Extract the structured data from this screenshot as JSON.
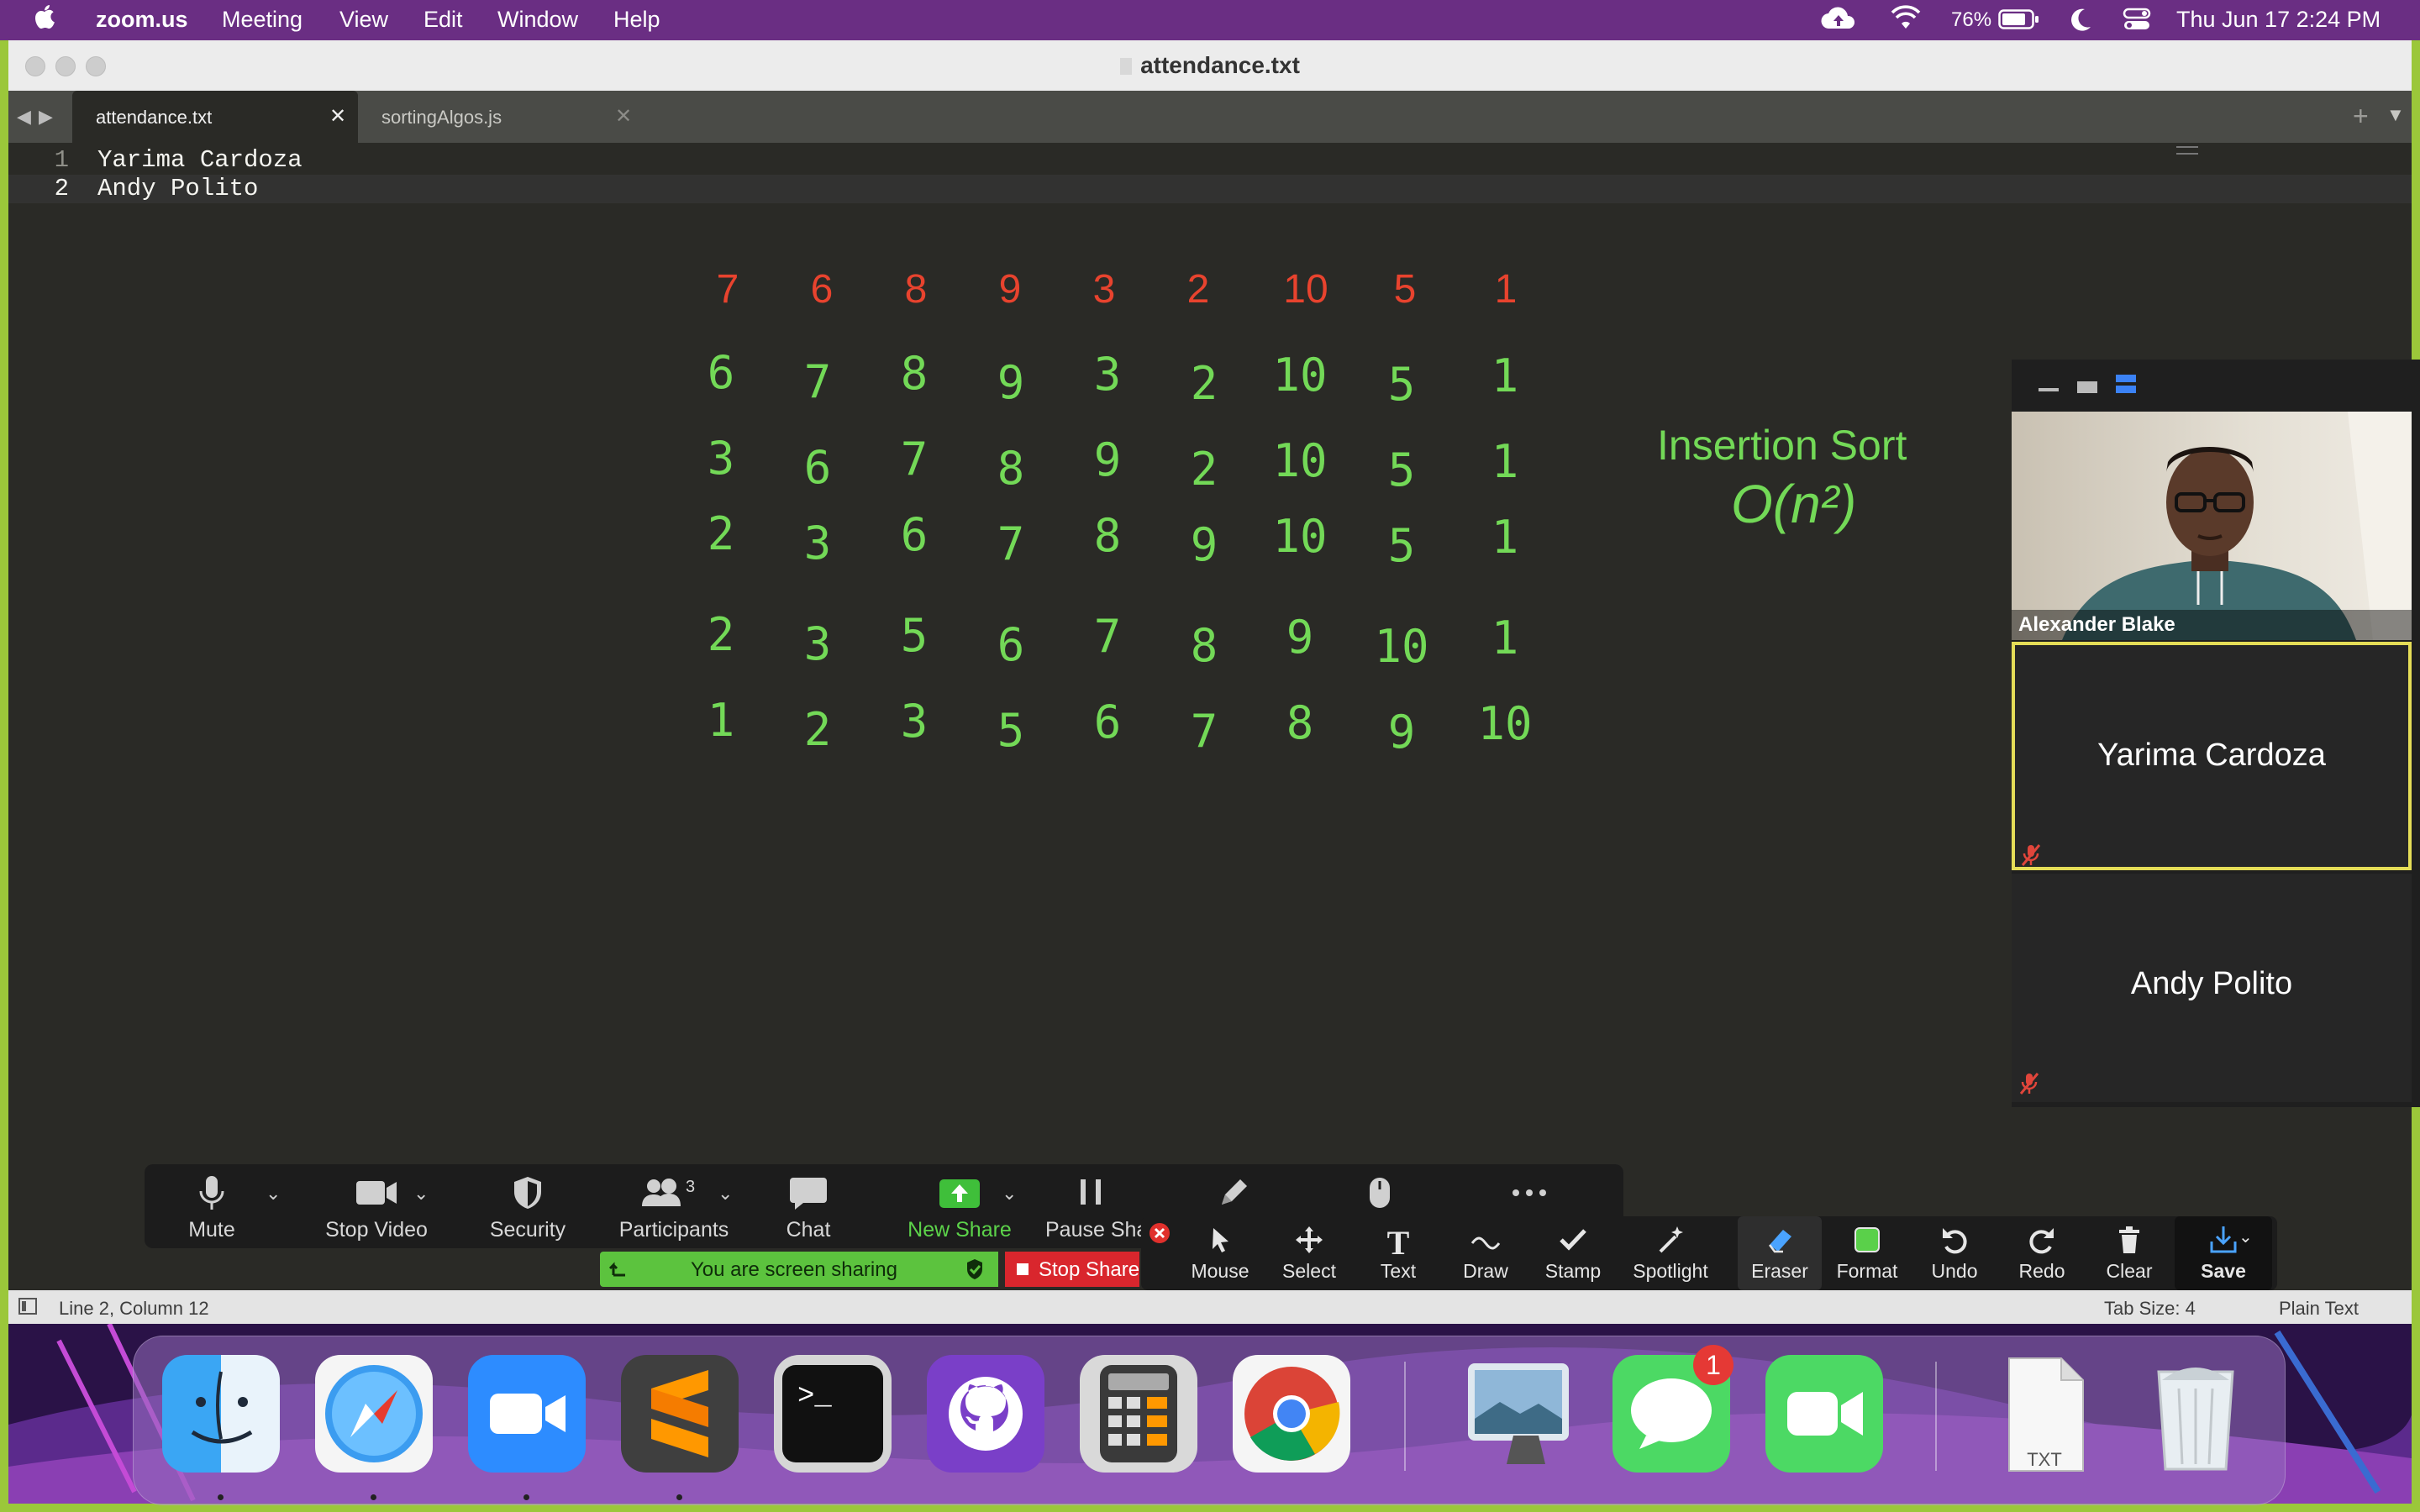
{
  "menubar": {
    "app_name": "zoom.us",
    "items": [
      "Meeting",
      "View",
      "Edit",
      "Window",
      "Help"
    ],
    "battery": "76%",
    "datetime": "Thu Jun 17  2:24 PM"
  },
  "window": {
    "title": "attendance.txt"
  },
  "tabs": [
    {
      "label": "attendance.txt",
      "active": true
    },
    {
      "label": "sortingAlgos.js",
      "active": false
    }
  ],
  "editor": {
    "lines": [
      {
        "num": "1",
        "text": "Yarima Cardoza"
      },
      {
        "num": "2",
        "text": "Andy Polito"
      }
    ]
  },
  "annotation": {
    "original_row": [
      "7",
      "6",
      "8",
      "9",
      "3",
      "2",
      "10",
      "5",
      "1"
    ],
    "passes": [
      [
        "6",
        "7",
        "8",
        "9",
        "3",
        "2",
        "10",
        "5",
        "1"
      ],
      [
        "3",
        "6",
        "7",
        "8",
        "9",
        "2",
        "10",
        "5",
        "1"
      ],
      [
        "2",
        "3",
        "6",
        "7",
        "8",
        "9",
        "10",
        "5",
        "1"
      ],
      [
        "2",
        "3",
        "5",
        "6",
        "7",
        "8",
        "9",
        "10",
        "1"
      ],
      [
        "1",
        "2",
        "3",
        "5",
        "6",
        "7",
        "8",
        "9",
        "10"
      ]
    ],
    "title": "Insertion Sort",
    "complexity": "O(n²)",
    "colors": {
      "original": "#e8432e",
      "handwriting": "#73d957"
    }
  },
  "participants_panel": {
    "tiles": [
      {
        "name": "Alexander Blake",
        "video": true
      },
      {
        "name": "Yarima Cardoza",
        "video": false,
        "muted": true,
        "active": true
      },
      {
        "name": "Andy Polito",
        "video": false,
        "muted": true
      }
    ]
  },
  "zoom_toolbar": {
    "mute": "Mute",
    "stop_video": "Stop Video",
    "security": "Security",
    "participants": "Participants",
    "participants_count": "3",
    "chat": "Chat",
    "new_share": "New Share",
    "pause_share": "Pause Share"
  },
  "sharing": {
    "status": "You are screen sharing",
    "stop": "Stop Share"
  },
  "annotate_toolbar": {
    "items": [
      "Mouse",
      "Select",
      "Text",
      "Draw",
      "Stamp",
      "Spotlight",
      "Eraser",
      "Format",
      "Undo",
      "Redo",
      "Clear",
      "Save"
    ]
  },
  "statusbar": {
    "position": "Line 2, Column 12",
    "tab_size": "Tab Size: 4",
    "syntax": "Plain Text"
  },
  "dock": {
    "apps": [
      "Finder",
      "Safari",
      "Zoom",
      "Sublime Text",
      "Terminal",
      "GitHub Desktop",
      "Calculator",
      "Chrome",
      "Preview",
      "Messages",
      "FaceTime",
      "TXT Document",
      "Trash"
    ],
    "messages_badge": "1",
    "txt_label": "TXT"
  }
}
